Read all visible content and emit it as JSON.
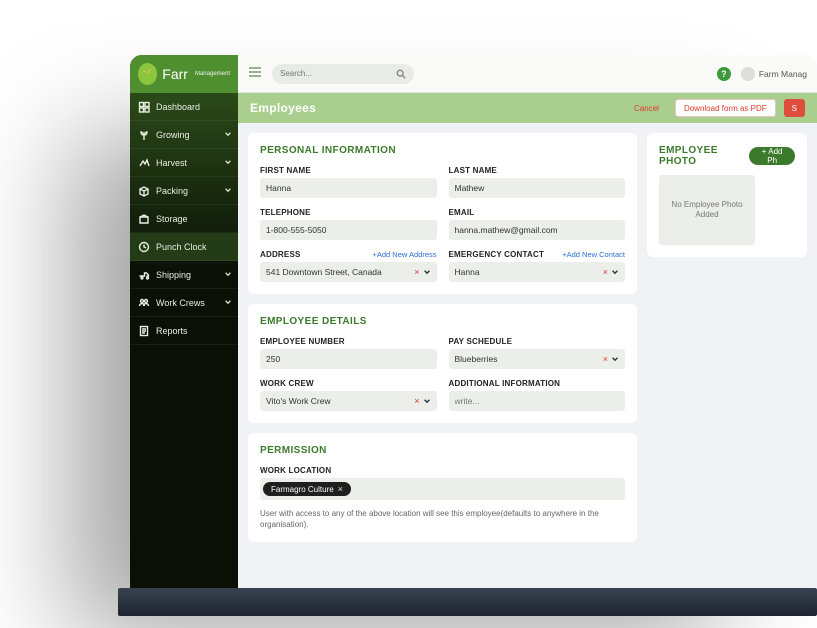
{
  "brand": {
    "name": "Farr",
    "sub": "Management"
  },
  "topbar": {
    "search_ph": "Search...",
    "user": "Farm Manag"
  },
  "titlebar": {
    "title": "Employees",
    "cancel": "Cancel",
    "download": "Download form as PDF",
    "save": "S"
  },
  "sidebar": {
    "items": [
      {
        "label": "Dashboard",
        "icon": "dashboard"
      },
      {
        "label": "Growing",
        "icon": "growing",
        "expand": true
      },
      {
        "label": "Harvest",
        "icon": "harvest",
        "expand": true
      },
      {
        "label": "Packing",
        "icon": "packing",
        "expand": true
      },
      {
        "label": "Storage",
        "icon": "storage"
      },
      {
        "label": "Punch Clock",
        "icon": "clock",
        "active": true
      },
      {
        "label": "Shipping",
        "icon": "shipping",
        "expand": true
      },
      {
        "label": "Work Crews",
        "icon": "crews",
        "expand": true
      },
      {
        "label": "Reports",
        "icon": "reports"
      }
    ]
  },
  "sections": {
    "personal": {
      "title": "PERSONAL INFORMATION",
      "first_name": {
        "label": "FIRST NAME",
        "value": "Hanna"
      },
      "last_name": {
        "label": "LAST NAME",
        "value": "Mathew"
      },
      "telephone": {
        "label": "TELEPHONE",
        "value": "1-800-555-5050"
      },
      "email": {
        "label": "EMAIL",
        "value": "hanna.mathew@gmail.com"
      },
      "address": {
        "label": "ADDRESS",
        "value": "541 Downtown Street, Canada",
        "link": "+Add New Address"
      },
      "emergency": {
        "label": "EMERGENCY CONTACT",
        "value": "Hanna",
        "link": "+Add New Contact"
      }
    },
    "details": {
      "title": "EMPLOYEE DETAILS",
      "emp_no": {
        "label": "EMPLOYEE NUMBER",
        "value": "250"
      },
      "pay": {
        "label": "PAY SCHEDULE",
        "value": "Blueberries"
      },
      "crew": {
        "label": "WORK CREW",
        "value": "Vito's Work Crew"
      },
      "info": {
        "label": "ADDITIONAL INFORMATION",
        "placeholder": "write..."
      }
    },
    "permission": {
      "title": "PERMISSION",
      "location": {
        "label": "WORK LOCATION",
        "chip": "Farmagro Culture"
      },
      "note": "User with access to any of the above location will see this employee(defaults to anywhere in the organisation)."
    },
    "photo": {
      "title": "EMPLOYEE PHOTO",
      "add": "+ Add Ph",
      "empty": "No Employee\nPhoto Added"
    }
  }
}
